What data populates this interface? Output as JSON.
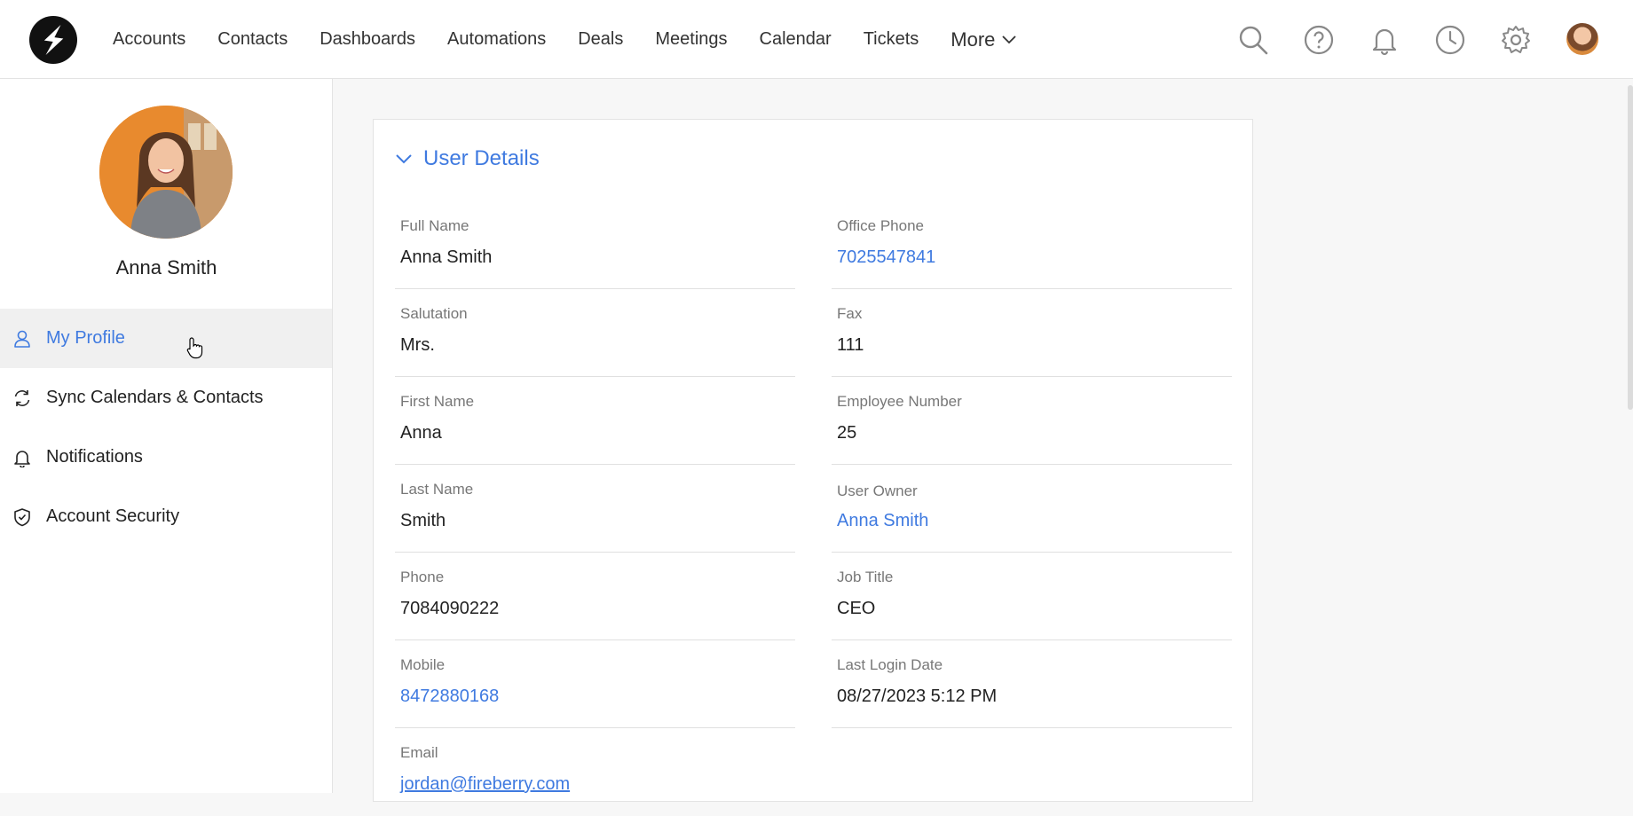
{
  "nav": {
    "items": [
      "Accounts",
      "Contacts",
      "Dashboards",
      "Automations",
      "Deals",
      "Meetings",
      "Calendar",
      "Tickets"
    ],
    "more_label": "More",
    "icons": [
      "search-icon",
      "help-icon",
      "bell-icon",
      "clock-icon",
      "gear-icon"
    ]
  },
  "sidebar": {
    "user_name": "Anna Smith",
    "items": [
      {
        "label": "My Profile",
        "icon": "user-icon",
        "active": true
      },
      {
        "label": "Sync Calendars & Contacts",
        "icon": "sync-icon",
        "active": false
      },
      {
        "label": "Notifications",
        "icon": "bell-icon",
        "active": false
      },
      {
        "label": "Account Security",
        "icon": "shield-icon",
        "active": false
      }
    ]
  },
  "details": {
    "title": "User Details",
    "left": [
      {
        "label": "Full Name",
        "value": "Anna Smith",
        "link": false
      },
      {
        "label": "Salutation",
        "value": "Mrs.",
        "link": false
      },
      {
        "label": "First Name",
        "value": "Anna",
        "link": false
      },
      {
        "label": "Last Name",
        "value": "Smith",
        "link": false
      },
      {
        "label": "Phone",
        "value": "7084090222",
        "link": false
      },
      {
        "label": "Mobile",
        "value": "8472880168",
        "link": true
      },
      {
        "label": "Email",
        "value": "jordan@fireberry.com",
        "link": true
      }
    ],
    "right": [
      {
        "label": "Office Phone",
        "value": "7025547841",
        "link": true
      },
      {
        "label": "Fax",
        "value": "111",
        "link": false
      },
      {
        "label": "Employee Number",
        "value": "25",
        "link": false
      },
      {
        "label": "User Owner",
        "value": "Anna Smith",
        "link": true
      },
      {
        "label": "Job Title",
        "value": "CEO",
        "link": false
      },
      {
        "label": "Last Login Date",
        "value": "08/27/2023 5:12 PM",
        "link": false
      }
    ]
  },
  "colors": {
    "accent": "#3f7ae0",
    "active_bg": "#f0f0f0"
  }
}
